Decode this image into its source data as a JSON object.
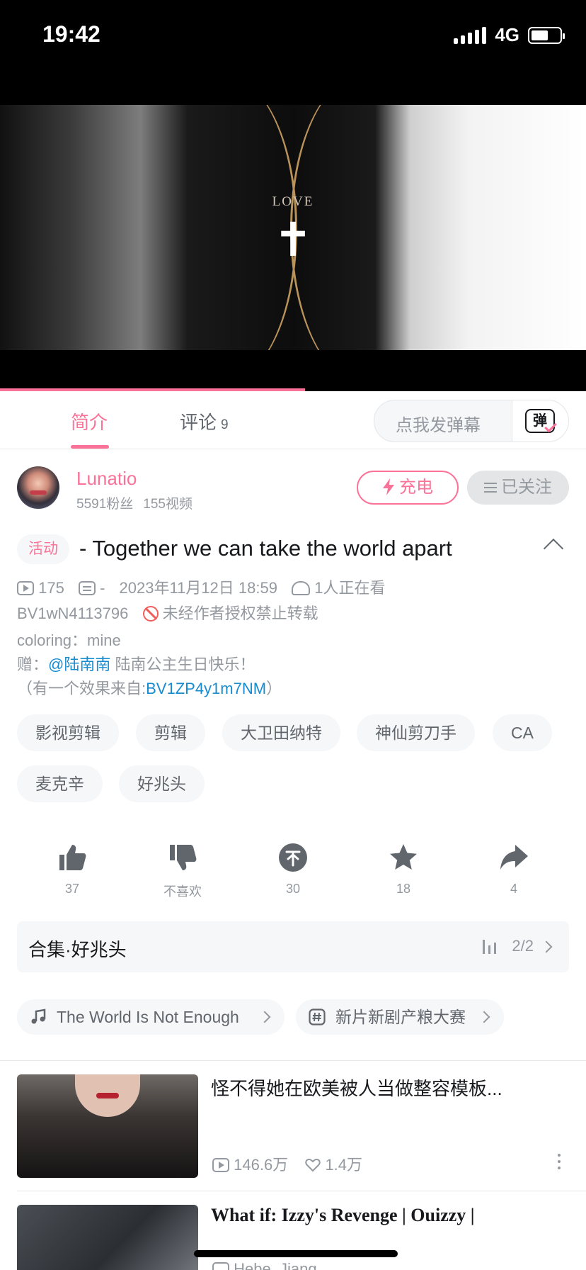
{
  "status_bar": {
    "time": "19:42",
    "network": "4G"
  },
  "player": {
    "overlay_text": "LOVE",
    "overlay_symbol": "✝",
    "progress": 0.52
  },
  "tabs": {
    "intro_label": "简介",
    "comments_label": "评论",
    "comments_count": "9",
    "danmaku_placeholder": "点我发弹幕",
    "danmaku_icon_char": "弹"
  },
  "uploader": {
    "name": "Lunatio",
    "fans": "5591粉丝",
    "videos": "155视频",
    "charge_label": "充电",
    "follow_label": "已关注"
  },
  "video": {
    "activity_tag": "活动",
    "title": "- Together we can take the world apart",
    "plays": "175",
    "danmaku_count": "-",
    "date": "2023年11月12日 18:59",
    "watching": "1人正在看",
    "bvid": "BV1wN4113796",
    "copyright": "未经作者授权禁止转载",
    "desc_coloring": "coloring：mine",
    "desc_gift_prefix": "赠：",
    "desc_gift_mention": "@陆南南",
    "desc_gift_text": " 陆南公主生日快乐！",
    "desc_effect_prefix": "（有一个效果来自:",
    "desc_effect_link": "BV1ZP4y1m7NM",
    "desc_effect_suffix": "）"
  },
  "tags": [
    "影视剪辑",
    "剪辑",
    "大卫田纳特",
    "神仙剪刀手",
    "CA",
    "麦克辛",
    "好兆头"
  ],
  "actions": {
    "like": "37",
    "dislike": "不喜欢",
    "coin": "30",
    "favorite": "18",
    "share": "4"
  },
  "collection": {
    "name": "合集·好兆头",
    "position": "2/2"
  },
  "chips": {
    "music": "The World Is Not Enough",
    "event": "新片新剧产粮大赛"
  },
  "recommendations": [
    {
      "title": "怪不得她在欧美被人当做整容模板...",
      "plays": "146.6万",
      "likes": "1.4万"
    },
    {
      "title": "What if: Izzy's Revenge | Ouizzy |",
      "uploader": "Hebe_Jiang"
    }
  ],
  "colors": {
    "accent": "#fb7299",
    "link": "#178bcf",
    "muted": "#9499a0",
    "warning": "#f25d59"
  }
}
